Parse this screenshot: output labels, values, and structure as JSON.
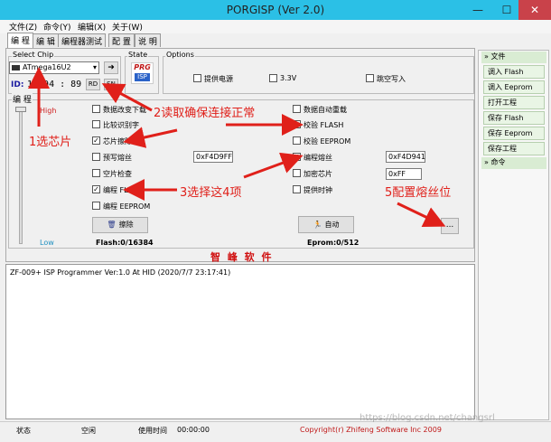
{
  "window": {
    "title": "PORGISP (Ver 2.0)",
    "min": "—",
    "max": "☐",
    "close": "✕"
  },
  "menu": [
    "文件(Z)",
    "命令(Y)",
    "编辑(X)",
    "关于(W)"
  ],
  "tabs": [
    "编 程",
    "编 辑",
    "编程器测试",
    "配 置",
    "说 明"
  ],
  "select_chip": {
    "label": "Select Chip",
    "chip_value": "ATmega16U2",
    "id_label": "ID:",
    "id_value": "1E 94 : 89",
    "rd_label": "RD",
    "sn_label": "SN",
    "go_arrow": "➜"
  },
  "state": {
    "label": "State",
    "logo_text": "PRG",
    "logo_sub": "ISP"
  },
  "options": {
    "label": "Options",
    "items": [
      {
        "label": "提供电源",
        "checked": false
      },
      {
        "label": "3.3V",
        "checked": false
      },
      {
        "label": "跳空写入",
        "checked": false
      }
    ]
  },
  "programming": {
    "label": "编 程",
    "high": "High",
    "low": "Low",
    "left_items": [
      {
        "label": "数据改变下载",
        "checked": false
      },
      {
        "label": "比较识别字",
        "checked": false
      },
      {
        "label": "芯片擦除",
        "checked": true
      },
      {
        "label": "预写熔丝",
        "checked": false
      },
      {
        "label": "空片检查",
        "checked": false
      },
      {
        "label": "编程 FLASH",
        "checked": true
      },
      {
        "label": "编程 EEPROM",
        "checked": false
      }
    ],
    "right_items": [
      {
        "label": "数据自动重载",
        "checked": false
      },
      {
        "label": "校验 FLASH",
        "checked": true
      },
      {
        "label": "校验 EEPROM",
        "checked": false
      },
      {
        "label": "编程熔丝",
        "checked": true
      },
      {
        "label": "加密芯片",
        "checked": false
      },
      {
        "label": "提供时钟",
        "checked": false
      }
    ],
    "prewrite_fuse_value": "0xF4D9FF",
    "fuse_value": "0xF4D941",
    "lock_value": "0xFF",
    "erase_button": "擦除",
    "auto_button": "自动",
    "ellipsis_button": "...",
    "flash_counter": "Flash:0/16384",
    "eprom_counter": "Eprom:0/512"
  },
  "brand": "智 峰 软 件",
  "log": [
    "ZF-009+ ISP Programmer Ver:1.0 At HID (2020/7/7 23:17:41)"
  ],
  "annotations": {
    "step1": "1选芯片",
    "step2": "2读取确保连接正常",
    "step3": "3选择这4项",
    "step5": "5配置熔丝位",
    "color": "#e0201a"
  },
  "sidepanel": {
    "file_header": "文件",
    "file_items": [
      "调入 Flash",
      "调入 Eeprom",
      "打开工程",
      "保存 Flash",
      "保存 Eeprom",
      "保存工程"
    ],
    "command_header": "命令"
  },
  "statusbar": {
    "state_label": "状态",
    "state_value": "空闲",
    "time_label": "使用时间",
    "time_value": "00:00:00",
    "copyright": "Copyright(r) Zhifeng Software Inc 2009",
    "watermark": "https://blog.csdn.net/changsrl"
  }
}
